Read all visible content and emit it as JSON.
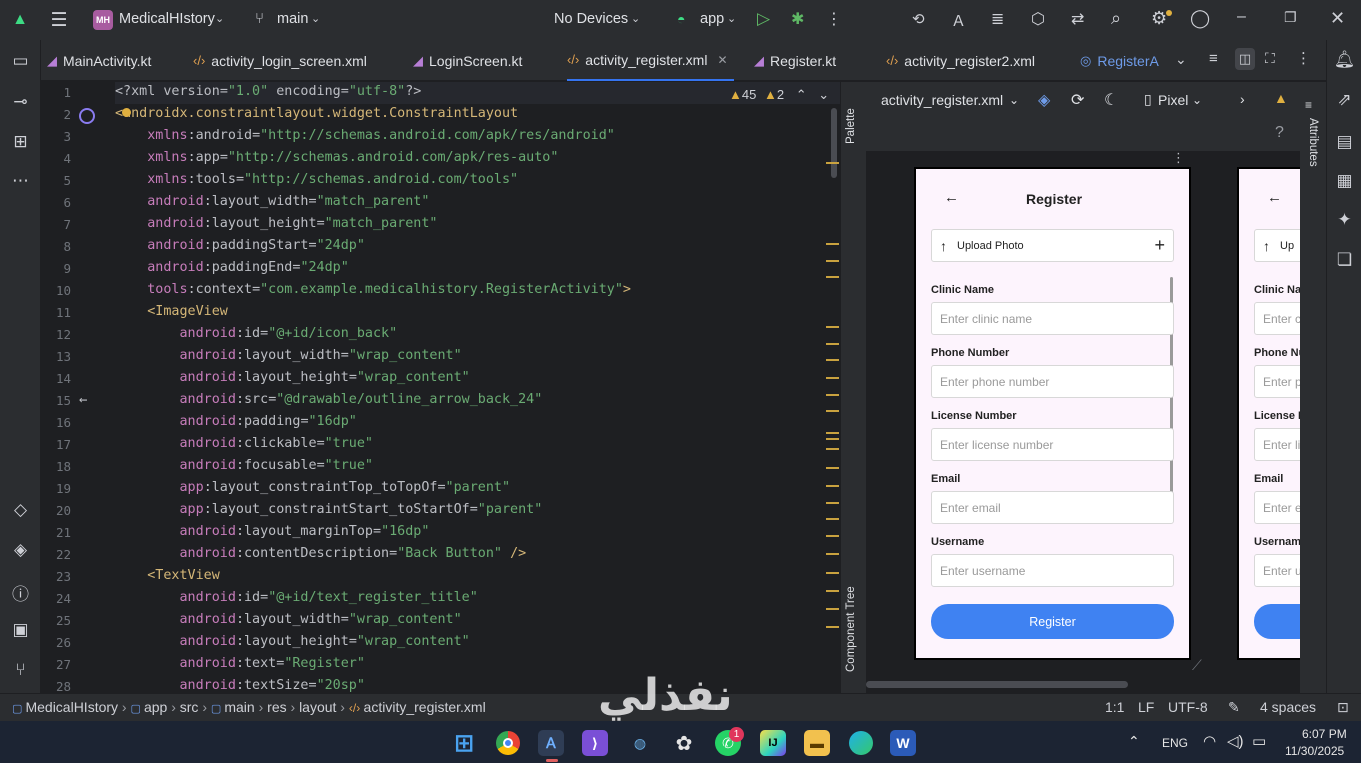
{
  "titlebar": {
    "project_initials": "MH",
    "project_name": "MedicalHIstory",
    "branch": "main",
    "device": "No Devices",
    "run_config": "app"
  },
  "tabs": [
    {
      "label": "MainActivity.kt",
      "icon": "kotlin-icon"
    },
    {
      "label": "activity_login_screen.xml",
      "icon": "xml-icon"
    },
    {
      "label": "LoginScreen.kt",
      "icon": "kotlin-icon"
    },
    {
      "label": "activity_register.xml",
      "icon": "xml-icon",
      "active": true
    },
    {
      "label": "Register.kt",
      "icon": "kotlin-icon"
    },
    {
      "label": "activity_register2.xml",
      "icon": "xml-icon"
    },
    {
      "label": "RegisterA",
      "icon": "compose-icon"
    }
  ],
  "editor": {
    "warnings": "45",
    "weak_warnings": "2",
    "line_numbers": [
      "1",
      "2",
      "3",
      "4",
      "5",
      "6",
      "7",
      "8",
      "9",
      "10",
      "11",
      "12",
      "13",
      "14",
      "15",
      "16",
      "17",
      "18",
      "19",
      "20",
      "21",
      "22",
      "23",
      "24",
      "25",
      "26",
      "27",
      "28"
    ],
    "lines": [
      "<?xml version=\"1.0\" encoding=\"utf-8\"?>",
      "<androidx.constraintlayout.widget.ConstraintLayout",
      "    xmlns:android=\"http://schemas.android.com/apk/res/android\"",
      "    xmlns:app=\"http://schemas.android.com/apk/res-auto\"",
      "    xmlns:tools=\"http://schemas.android.com/tools\"",
      "    android:layout_width=\"match_parent\"",
      "    android:layout_height=\"match_parent\"",
      "    android:paddingStart=\"24dp\"",
      "    android:paddingEnd=\"24dp\"",
      "    tools:context=\"com.example.medicalhistory.RegisterActivity\">",
      "    <ImageView",
      "        android:id=\"@+id/icon_back\"",
      "        android:layout_width=\"wrap_content\"",
      "        android:layout_height=\"wrap_content\"",
      "        android:src=\"@drawable/outline_arrow_back_24\"",
      "        android:padding=\"16dp\"",
      "        android:clickable=\"true\"",
      "        android:focusable=\"true\"",
      "        app:layout_constraintTop_toTopOf=\"parent\"",
      "        app:layout_constraintStart_toStartOf=\"parent\"",
      "        android:layout_marginTop=\"16dp\"",
      "        android:contentDescription=\"Back Button\" />",
      "    <TextView",
      "        android:id=\"@+id/text_register_title\"",
      "        android:layout_width=\"wrap_content\"",
      "        android:layout_height=\"wrap_content\"",
      "        android:text=\"Register\"",
      "        android:textSize=\"20sp\""
    ]
  },
  "design": {
    "file": "activity_register.xml",
    "device": "Pixel",
    "palette_label": "Palette",
    "component_tree_label": "Component Tree",
    "attributes_label": "Attributes",
    "preview": {
      "title": "Register",
      "upload_label": "Upload Photo",
      "fields": [
        {
          "label": "Clinic Name",
          "placeholder": "Enter clinic name"
        },
        {
          "label": "Phone Number",
          "placeholder": "Enter phone number"
        },
        {
          "label": "License Number",
          "placeholder": "Enter license number"
        },
        {
          "label": "Email",
          "placeholder": "Enter email"
        },
        {
          "label": "Username",
          "placeholder": "Enter username"
        }
      ],
      "button": "Register",
      "second_preview_fields": [
        {
          "label": "Clinic Na",
          "placeholder": "Enter c"
        },
        {
          "label": "Phone Nu",
          "placeholder": "Enter p"
        },
        {
          "label": "License N",
          "placeholder": "Enter lic"
        },
        {
          "label": "Email",
          "placeholder": "Enter e"
        },
        {
          "label": "Username",
          "placeholder": "Enter u"
        }
      ],
      "second_upload": "Up"
    }
  },
  "statusbar": {
    "breadcrumb": [
      "MedicalHIstory",
      "app",
      "src",
      "main",
      "res",
      "layout",
      "activity_register.xml"
    ],
    "position": "1:1",
    "line_sep": "LF",
    "encoding": "UTF-8",
    "indent": "4 spaces"
  },
  "taskbar": {
    "lang": "ENG",
    "time": "6:07 PM",
    "date": "11/30/2025",
    "whatsapp_badge": "1"
  },
  "watermark": "نفذلي"
}
